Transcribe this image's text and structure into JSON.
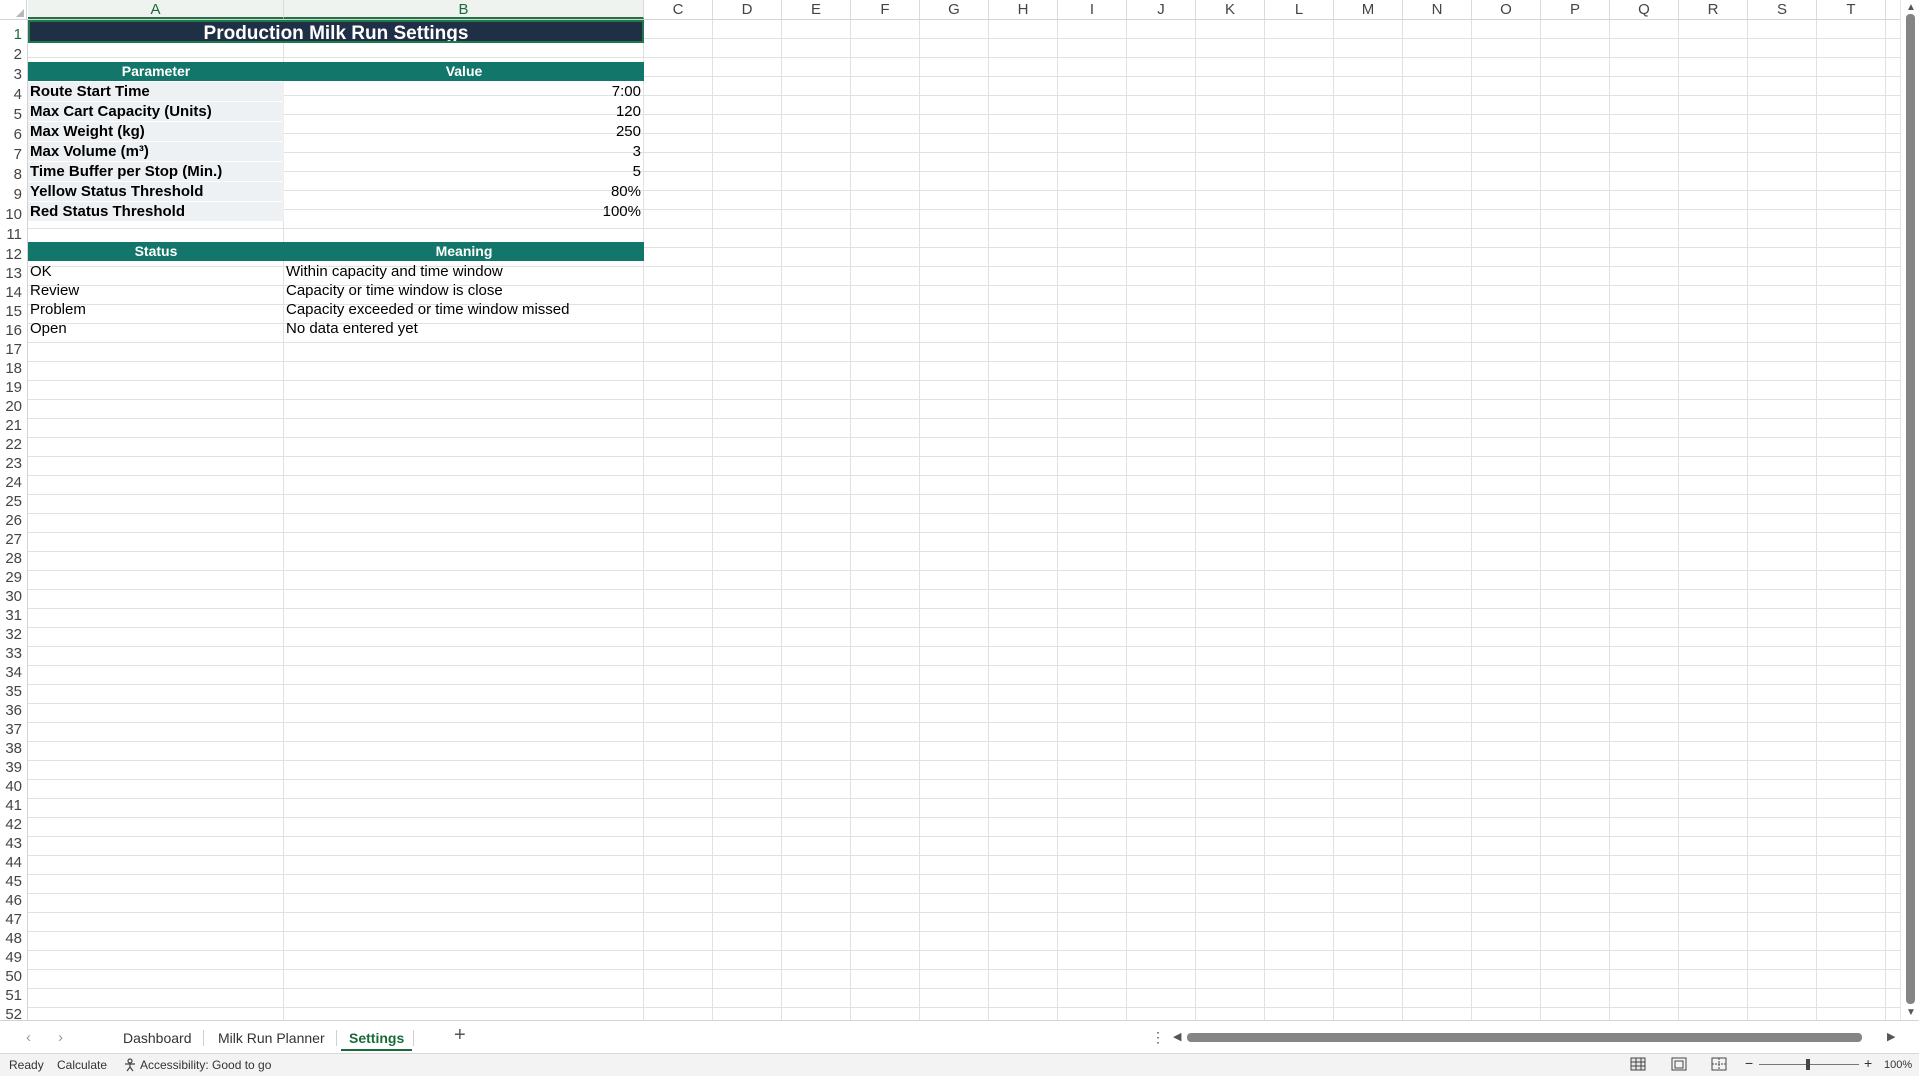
{
  "columns": [
    "A",
    "B",
    "C",
    "D",
    "E",
    "F",
    "G",
    "H",
    "I",
    "J",
    "K",
    "L",
    "M",
    "N",
    "O",
    "P",
    "Q",
    "R",
    "S",
    "T"
  ],
  "rows": [
    "1",
    "2",
    "3",
    "4",
    "5",
    "6",
    "7",
    "8",
    "9",
    "10",
    "11",
    "12",
    "13",
    "14",
    "15",
    "16",
    "17",
    "18",
    "19",
    "20",
    "21",
    "22",
    "23",
    "24",
    "25",
    "26",
    "27",
    "28",
    "29",
    "30",
    "31",
    "32",
    "33",
    "34",
    "35",
    "36",
    "37",
    "38",
    "39",
    "40",
    "41",
    "42",
    "43",
    "44",
    "45",
    "46",
    "47",
    "48",
    "49",
    "50",
    "51",
    "52"
  ],
  "sheet": {
    "title": "Production Milk Run Settings",
    "params_header": {
      "parameter": "Parameter",
      "value": "Value"
    },
    "params": [
      {
        "label": "Route Start Time",
        "value": "7:00"
      },
      {
        "label": "Max Cart Capacity (Units)",
        "value": "120"
      },
      {
        "label": "Max Weight (kg)",
        "value": "250"
      },
      {
        "label": "Max Volume (m³)",
        "value": "3"
      },
      {
        "label": "Time Buffer per Stop (Min.)",
        "value": "5"
      },
      {
        "label": "Yellow Status Threshold",
        "value": "80%"
      },
      {
        "label": "Red Status Threshold",
        "value": "100%"
      }
    ],
    "status_header": {
      "status": "Status",
      "meaning": "Meaning"
    },
    "statuses": [
      {
        "status": "OK",
        "meaning": "Within capacity and time window"
      },
      {
        "status": "Review",
        "meaning": "Capacity or time window is close"
      },
      {
        "status": "Problem",
        "meaning": "Capacity exceeded or time window missed"
      },
      {
        "status": "Open",
        "meaning": "No data entered yet"
      }
    ]
  },
  "tabs": {
    "items": [
      "Dashboard",
      "Milk Run Planner",
      "Settings"
    ],
    "active": "Settings",
    "add_label": "+"
  },
  "statusbar": {
    "ready": "Ready",
    "calculate": "Calculate",
    "accessibility": "Accessibility: Good to go",
    "zoom": "100%",
    "zoom_minus": "−",
    "zoom_plus": "+"
  },
  "colors": {
    "title_bg": "#1f2f45",
    "header_bg": "#12766a",
    "label_bg": "#eef1f4",
    "selection": "#217346"
  },
  "icons": [
    "select-all-icon",
    "prev-sheet-icon",
    "next-sheet-icon",
    "add-sheet-icon",
    "more-options-icon",
    "accessibility-icon",
    "normal-view-icon",
    "page-layout-icon",
    "page-break-icon"
  ]
}
